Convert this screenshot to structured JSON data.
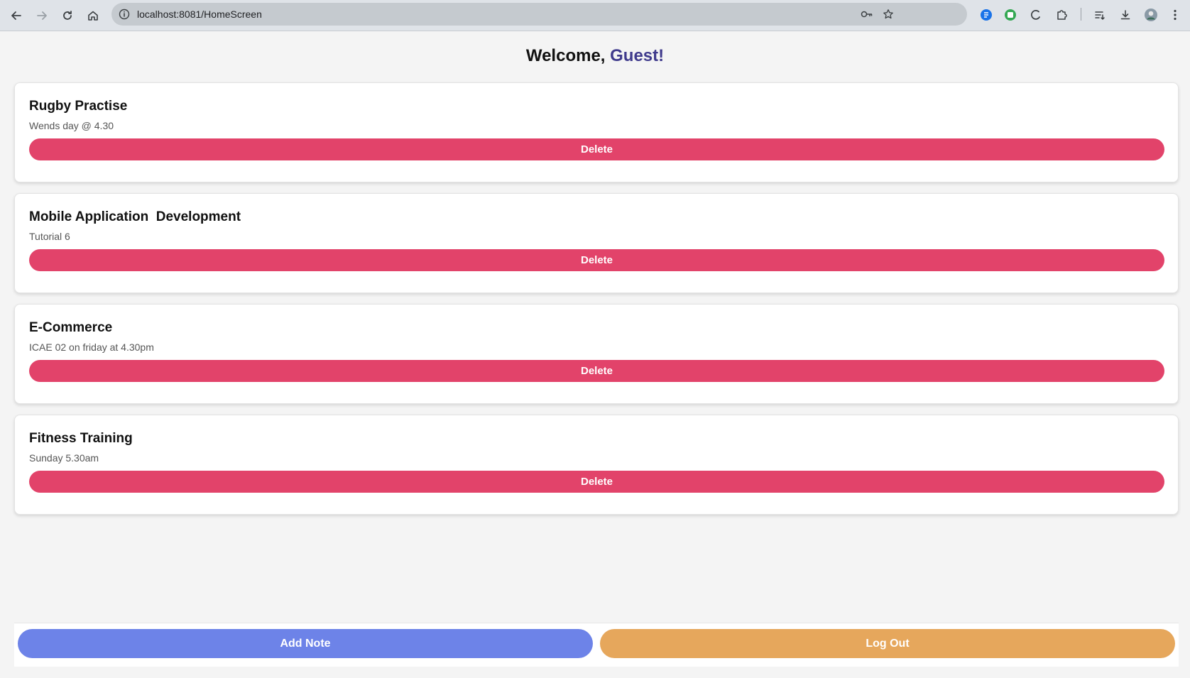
{
  "browser": {
    "url": "localhost:8081/HomeScreen"
  },
  "header": {
    "welcome_prefix": "Welcome, ",
    "username": "Guest!"
  },
  "notes": [
    {
      "title": "Rugby Practise",
      "description": "Wends day @ 4.30",
      "delete_label": "Delete"
    },
    {
      "title": "Mobile Application  Development",
      "description": "Tutorial 6",
      "delete_label": "Delete"
    },
    {
      "title": "E-Commerce",
      "description": "ICAE 02 on friday at 4.30pm",
      "delete_label": "Delete"
    },
    {
      "title": "Fitness Training",
      "description": "Sunday 5.30am",
      "delete_label": "Delete"
    }
  ],
  "footer": {
    "add_note_label": "Add Note",
    "logout_label": "Log Out"
  },
  "colors": {
    "delete": "#e2436a",
    "add_note": "#6d83e8",
    "logout": "#e6a75c",
    "username": "#3f3a8c"
  },
  "icons": {
    "toolbar": [
      "back-arrow-icon",
      "forward-arrow-icon",
      "reload-icon",
      "home-icon",
      "site-info-icon",
      "password-key-icon",
      "bookmark-star-icon",
      "extension-icon",
      "reading-list-icon",
      "download-icon",
      "profile-avatar-icon",
      "menu-kebab-icon"
    ]
  }
}
